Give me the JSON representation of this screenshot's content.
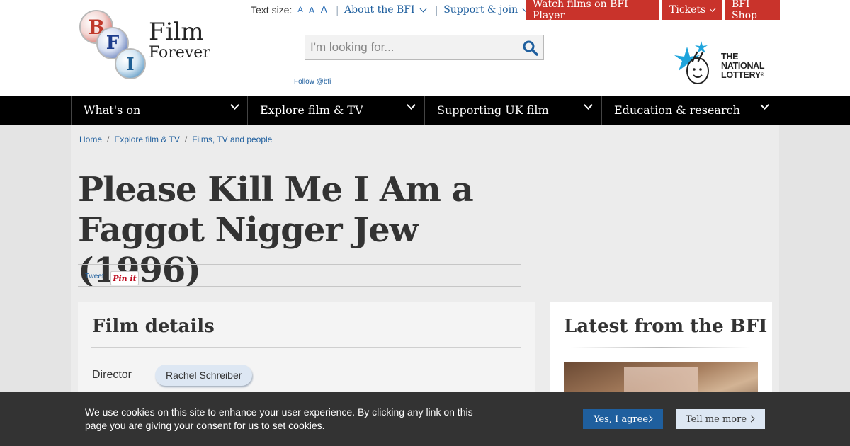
{
  "header": {
    "logo": {
      "letters": [
        "B",
        "F",
        "I"
      ],
      "line1": "Film",
      "line2": "Forever"
    },
    "text_size": {
      "label": "Text size:",
      "options": [
        "A",
        "A",
        "A"
      ]
    },
    "top_links": [
      {
        "label": "About the BFI"
      },
      {
        "label": "Support & join"
      }
    ],
    "red_buttons": [
      {
        "label": "Watch films on BFI Player"
      },
      {
        "label": "Tickets"
      },
      {
        "label": "BFI Shop"
      }
    ],
    "search": {
      "placeholder": "I'm looking for...",
      "icon": "search-icon"
    },
    "follow": "Follow @bfi",
    "lottery": {
      "line1": "THE",
      "line2": "NATIONAL",
      "line3": "LOTTERY",
      "reg": "®"
    }
  },
  "nav": [
    {
      "label": "What's on"
    },
    {
      "label": "Explore film & TV"
    },
    {
      "label": "Supporting UK film"
    },
    {
      "label": "Education & research"
    }
  ],
  "breadcrumb": [
    {
      "label": "Home"
    },
    {
      "label": "Explore film & TV"
    },
    {
      "label": "Films, TV and people"
    }
  ],
  "breadcrumb_sep": "/",
  "page_title": "Please Kill Me I Am a Faggot Nigger Jew (1996)",
  "share": {
    "tweet": "Tweet",
    "pinit": "Pin it"
  },
  "film_details": {
    "title": "Film details",
    "director_label": "Director",
    "director": "Rachel Schreiber"
  },
  "latest": {
    "title": "Latest from the BFI"
  },
  "cookie": {
    "text": "We use cookies on this site to enhance your user experience. By clicking any link on this page you are giving your consent for us to set cookies.",
    "agree": "Yes, I agree",
    "more": "Tell me more"
  },
  "colors": {
    "brand_red": "#c9332b",
    "link_blue": "#1f5f9e",
    "nav_black": "#000000",
    "cookie_bg": "#333333",
    "pill_bg": "#dde7f3"
  }
}
